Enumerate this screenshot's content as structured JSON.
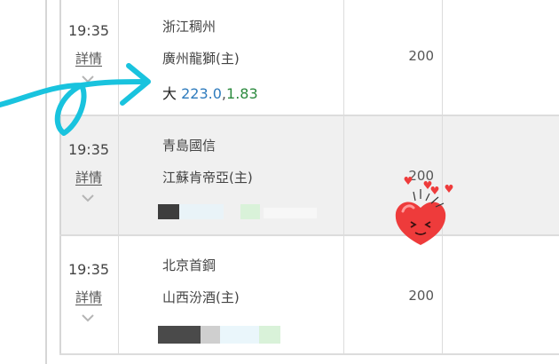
{
  "matches": [
    {
      "time": "19:35",
      "detail_label": "詳情",
      "team_a": "浙江稠州",
      "team_b": "廣州龍獅(主)",
      "value": "200",
      "odds": {
        "prefix": "大",
        "line": "223.0",
        "separator": ",",
        "price": "1.83"
      }
    },
    {
      "time": "19:35",
      "detail_label": "詳情",
      "team_a": "青島國信",
      "team_b": "江蘇肯帝亞(主)",
      "value": "200"
    },
    {
      "time": "19:35",
      "detail_label": "詳情",
      "team_a": "北京首鋼",
      "team_b": "山西汾酒(主)",
      "value": "200"
    }
  ],
  "colors": {
    "odds_line": "#2e7bbd",
    "odds_price": "#2b8a3e",
    "row_shade": "#f0f0f0",
    "arrow_doodle": "#19c3de",
    "heart_sticker": "#ee3b3b"
  },
  "icons": [
    "chevron-down-icon",
    "arrow-doodle",
    "heart-sticker"
  ]
}
